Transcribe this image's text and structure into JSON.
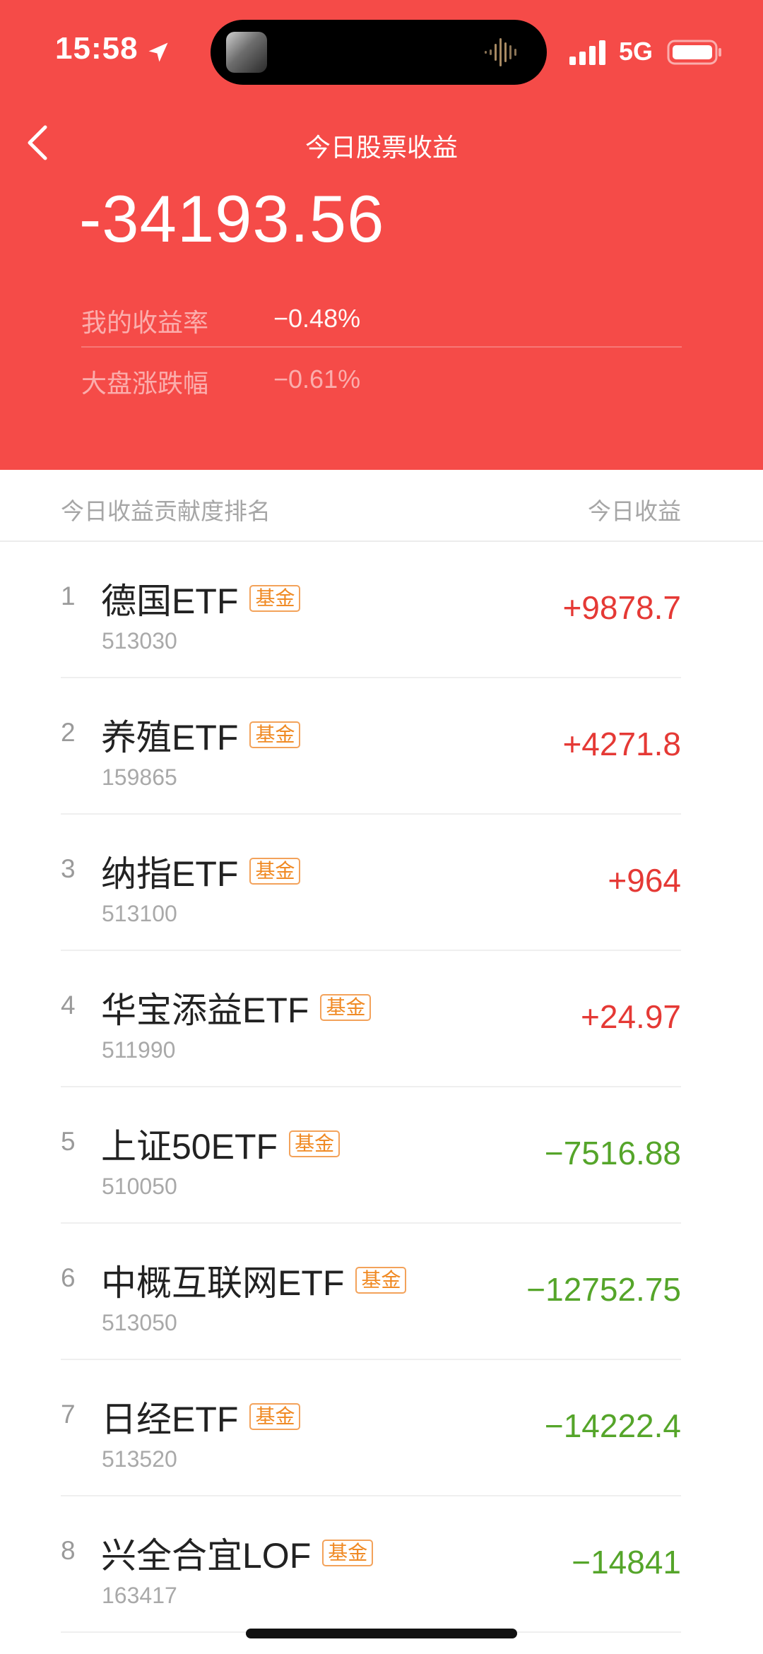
{
  "status_bar": {
    "time": "15:58",
    "network": "5G"
  },
  "nav": {
    "title": "今日股票收益"
  },
  "summary": {
    "total_profit": "-34193.56",
    "my_return_label": "我的收益率",
    "my_return_value": "−0.48%",
    "market_label": "大盘涨跌幅",
    "market_value": "−0.61%"
  },
  "list_header": {
    "left": "今日收益贡献度排名",
    "right": "今日收益"
  },
  "holdings": [
    {
      "rank": "1",
      "name": "德国ETF",
      "tag": "基金",
      "code": "513030",
      "profit": "+9878.7",
      "direction": "up"
    },
    {
      "rank": "2",
      "name": "养殖ETF",
      "tag": "基金",
      "code": "159865",
      "profit": "+4271.8",
      "direction": "up"
    },
    {
      "rank": "3",
      "name": "纳指ETF",
      "tag": "基金",
      "code": "513100",
      "profit": "+964",
      "direction": "up"
    },
    {
      "rank": "4",
      "name": "华宝添益ETF",
      "tag": "基金",
      "code": "511990",
      "profit": "+24.97",
      "direction": "up"
    },
    {
      "rank": "5",
      "name": "上证50ETF",
      "tag": "基金",
      "code": "510050",
      "profit": "−7516.88",
      "direction": "down"
    },
    {
      "rank": "6",
      "name": "中概互联网ETF",
      "tag": "基金",
      "code": "513050",
      "profit": "−12752.75",
      "direction": "down"
    },
    {
      "rank": "7",
      "name": "日经ETF",
      "tag": "基金",
      "code": "513520",
      "profit": "−14222.4",
      "direction": "down"
    },
    {
      "rank": "8",
      "name": "兴全合宜LOF",
      "tag": "基金",
      "code": "163417",
      "profit": "−14841",
      "direction": "down"
    }
  ],
  "colors": {
    "header_bg": "#f54b48",
    "profit_up": "#e53935",
    "profit_down": "#55a52a",
    "tag_orange": "#f08a24"
  }
}
